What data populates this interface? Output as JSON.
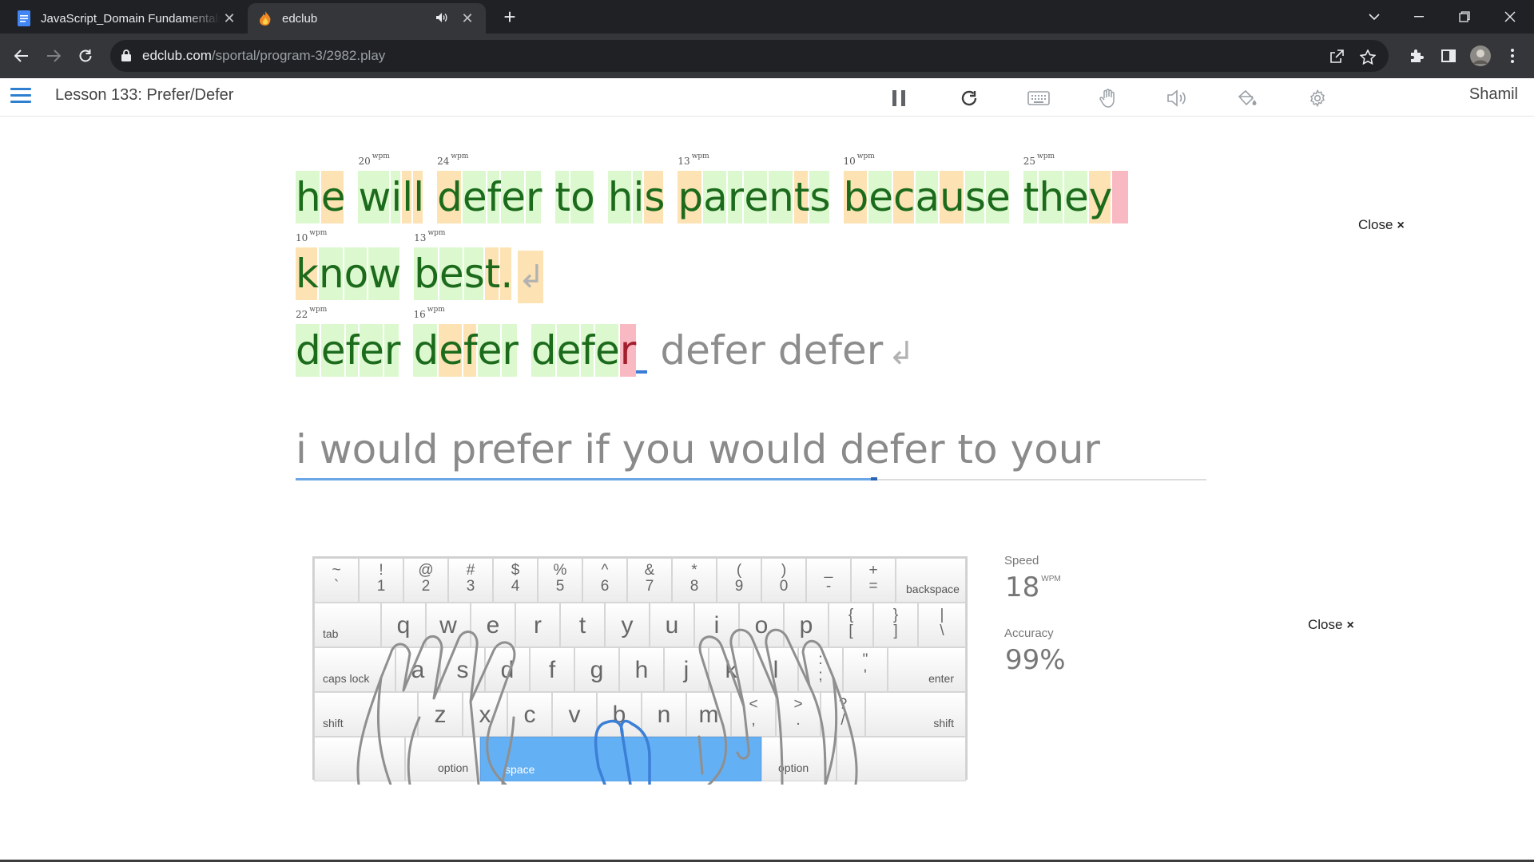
{
  "browser": {
    "tabs": [
      {
        "title": "JavaScript_Domain Fundamentals",
        "active": false
      },
      {
        "title": "edclub",
        "active": true
      }
    ],
    "url_host": "edclub.com",
    "url_path": "/sportal/program-3/2982.play"
  },
  "header": {
    "lesson_title": "Lesson 133: Prefer/Defer",
    "username": "Shamil",
    "icons": [
      "pause-icon",
      "restart-icon",
      "keyboard-icon",
      "hand-icon",
      "sound-icon",
      "paint-bucket-icon",
      "settings-icon"
    ]
  },
  "typing": {
    "lines": [
      {
        "words": [
          {
            "chars": [
              [
                "h",
                "ok"
              ],
              [
                "e",
                "slow"
              ]
            ]
          },
          {
            "wpm": "20",
            "chars": [
              [
                "w",
                "ok"
              ],
              [
                "i",
                "ok"
              ],
              [
                "l",
                "slow"
              ],
              [
                "l",
                "slow"
              ]
            ]
          },
          {
            "wpm": "24",
            "chars": [
              [
                "d",
                "slow"
              ],
              [
                "e",
                "ok"
              ],
              [
                "f",
                "ok"
              ],
              [
                "e",
                "ok"
              ],
              [
                "r",
                "ok"
              ]
            ]
          },
          {
            "chars": [
              [
                "t",
                "ok"
              ],
              [
                "o",
                "ok"
              ]
            ]
          },
          {
            "chars": [
              [
                "h",
                "ok"
              ],
              [
                "i",
                "ok"
              ],
              [
                "s",
                "slow"
              ]
            ]
          },
          {
            "wpm": "13",
            "chars": [
              [
                "p",
                "slow"
              ],
              [
                "a",
                "ok"
              ],
              [
                "r",
                "ok"
              ],
              [
                "e",
                "ok"
              ],
              [
                "n",
                "ok"
              ],
              [
                "t",
                "slow"
              ],
              [
                "s",
                "ok"
              ]
            ]
          },
          {
            "wpm": "10",
            "chars": [
              [
                "b",
                "slow"
              ],
              [
                "e",
                "ok"
              ],
              [
                "c",
                "slow"
              ],
              [
                "a",
                "ok"
              ],
              [
                "u",
                "slow"
              ],
              [
                "s",
                "ok"
              ],
              [
                "e",
                "ok"
              ]
            ]
          },
          {
            "wpm": "25",
            "chars": [
              [
                "t",
                "ok"
              ],
              [
                "h",
                "ok"
              ],
              [
                "e",
                "ok"
              ],
              [
                "y",
                "slow"
              ]
            ],
            "trail_error": true
          }
        ]
      },
      {
        "words": [
          {
            "wpm": "10",
            "chars": [
              [
                "k",
                "slow"
              ],
              [
                "n",
                "ok"
              ],
              [
                "o",
                "ok"
              ],
              [
                "w",
                "ok"
              ]
            ]
          },
          {
            "wpm": "13",
            "chars": [
              [
                "b",
                "ok"
              ],
              [
                "e",
                "ok"
              ],
              [
                "s",
                "ok"
              ],
              [
                "t",
                "slow"
              ],
              [
                ".",
                "slow"
              ]
            ],
            "return": true
          }
        ]
      },
      {
        "words": [
          {
            "wpm": "22",
            "chars": [
              [
                "d",
                "ok"
              ],
              [
                "e",
                "ok"
              ],
              [
                "f",
                "ok"
              ],
              [
                "e",
                "ok"
              ],
              [
                "r",
                "ok"
              ]
            ]
          },
          {
            "wpm": "16",
            "chars": [
              [
                "d",
                "ok"
              ],
              [
                "e",
                "slow"
              ],
              [
                "f",
                "slow"
              ],
              [
                "e",
                "ok"
              ],
              [
                "r",
                "ok"
              ]
            ]
          },
          {
            "chars": [
              [
                "d",
                "ok"
              ],
              [
                "e",
                "ok"
              ],
              [
                "f",
                "ok"
              ],
              [
                "e",
                "ok"
              ],
              [
                "r",
                "err"
              ]
            ],
            "cursor": true
          },
          {
            "chars": [
              [
                "d",
                "pending"
              ],
              [
                "e",
                "pending"
              ],
              [
                "f",
                "pending"
              ],
              [
                "e",
                "pending"
              ],
              [
                "r",
                "pending"
              ]
            ]
          },
          {
            "chars": [
              [
                "d",
                "pending"
              ],
              [
                "e",
                "pending"
              ],
              [
                "f",
                "pending"
              ],
              [
                "e",
                "pending"
              ],
              [
                "r",
                "pending"
              ]
            ],
            "return": true
          }
        ]
      }
    ],
    "next_line": "i would prefer if you would defer to your",
    "return_symbol": "↲",
    "wpm_unit": "wpm"
  },
  "close_labels": {
    "top": "Close",
    "bottom": "Close",
    "x": "×"
  },
  "stats": {
    "speed_label": "Speed",
    "speed_value": "18",
    "speed_unit": "WPM",
    "accuracy_label": "Accuracy",
    "accuracy_value": "99%"
  },
  "keyboard": {
    "rows": [
      [
        [
          "~",
          "`"
        ],
        [
          "!",
          "1"
        ],
        [
          "@",
          "2"
        ],
        [
          "#",
          "3"
        ],
        [
          "$",
          "4"
        ],
        [
          "%",
          "5"
        ],
        [
          "^",
          "6"
        ],
        [
          "&",
          "7"
        ],
        [
          "*",
          "8"
        ],
        [
          "(",
          "9"
        ],
        [
          ")",
          "0"
        ],
        [
          "_",
          "-"
        ],
        [
          "+",
          "="
        ]
      ],
      [
        "q",
        "w",
        "e",
        "r",
        "t",
        "y",
        "u",
        "i",
        "o",
        "p",
        [
          "{",
          "["
        ],
        [
          "}",
          "]"
        ],
        [
          "|",
          "\\"
        ]
      ],
      [
        "a",
        "s",
        "d",
        "f",
        "g",
        "h",
        "j",
        "k",
        "l",
        [
          ":",
          ";"
        ],
        [
          "\"",
          "'"
        ]
      ],
      [
        "z",
        "x",
        "c",
        "v",
        "b",
        "n",
        "m",
        [
          "<",
          ","
        ],
        [
          ">",
          "."
        ],
        [
          "?",
          "/"
        ]
      ]
    ],
    "labels": {
      "backspace": "backspace",
      "tab": "tab",
      "caps_lock": "caps lock",
      "enter": "enter",
      "shift_left": "shift",
      "shift_right": "shift",
      "option_left": "option",
      "space": "space",
      "option_right": "option"
    },
    "highlight_key": "space"
  }
}
